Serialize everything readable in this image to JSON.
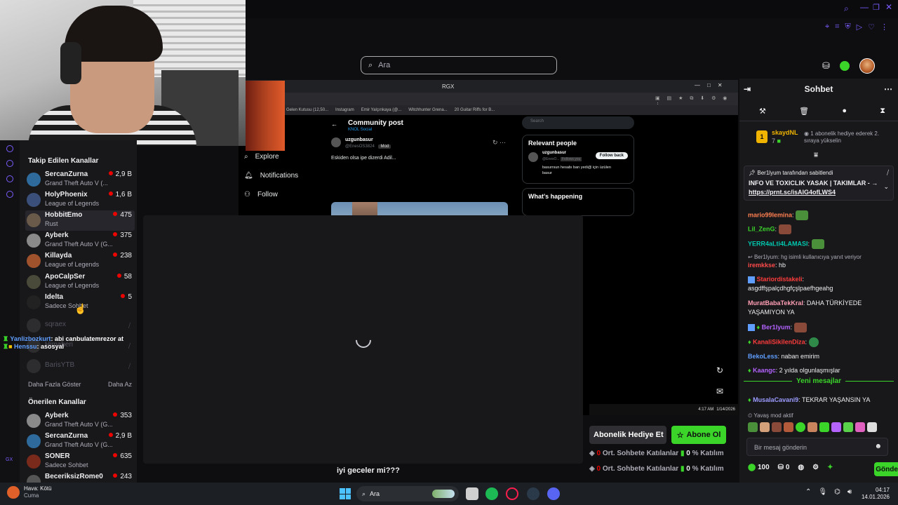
{
  "top_search": {
    "placeholder": "Ara"
  },
  "left_sidebar": {
    "followed_title": "Takip Edilen Kanallar",
    "followed": [
      {
        "name": "SercanZurna",
        "game": "Grand Theft Auto V (...",
        "viewers": "2,9 B"
      },
      {
        "name": "HolyPhoenix",
        "game": "League of Legends",
        "viewers": "1,6 B"
      },
      {
        "name": "HobbitEmo",
        "game": "Rust",
        "viewers": "475"
      },
      {
        "name": "Ayberk",
        "game": "Grand Theft Auto V (G...",
        "viewers": "375"
      },
      {
        "name": "Killayda",
        "game": "League of Legends",
        "viewers": "238"
      },
      {
        "name": "ApoCalpSer",
        "game": "League of Legends",
        "viewers": "58"
      },
      {
        "name": "Idelta",
        "game": "Sadece Sohbet",
        "viewers": "5"
      }
    ],
    "offline": [
      "sqraex",
      "Himaberi",
      "BarisYTB"
    ],
    "show_more": "Daha Fazla Göster",
    "show_less": "Daha Az",
    "recommended_title": "Önerilen Kanallar",
    "recommended": [
      {
        "name": "Ayberk",
        "game": "Grand Theft Auto V (G...",
        "viewers": "353"
      },
      {
        "name": "SercanZurna",
        "game": "Grand Theft Auto V (G...",
        "viewers": "2,9 B"
      },
      {
        "name": "SONER",
        "game": "Sadece Sohbet",
        "viewers": "635"
      },
      {
        "name": "BeceriksizRome0",
        "game": "",
        "viewers": "243"
      }
    ],
    "overlay_chat": [
      {
        "user": "Yanlizbozkurt",
        "text": ": abi canbulatemrezor at"
      },
      {
        "user": "Henssu",
        "text": ": asosyal"
      }
    ]
  },
  "embedded_browser": {
    "tab_title": "RGX",
    "bookmarks": [
      "Gelen Kutusu (12,50...",
      "Instagram",
      "Emir Yalçınkaya (@...",
      "Witchhunter Grena...",
      "20 Guitar Riffs for B..."
    ],
    "nav": [
      "Explore",
      "Notifications",
      "Follow"
    ],
    "post_header": "Community post",
    "post_sub": "KNOL Social",
    "post_user": "uzgunbasur",
    "post_handle": "@EnesOS3824",
    "post_badge": "Mod",
    "post_text": "Eskiden olsa ipe dizerdi Adil...",
    "search_placeholder": "Search",
    "relevant_title": "Relevant people",
    "relevant_user": "uzgunbasur",
    "relevant_handle": "@EnesO...",
    "relevant_badge": "Follows you",
    "relevant_bio": "basurrsun hesabı ban yedi@ için üzülen basur",
    "follow_back": "Follow back",
    "happening_title": "What's happening",
    "clock_time": "4:17 AM",
    "clock_date": "1/14/2026"
  },
  "modal": {
    "caption": "iyi geceler mi???"
  },
  "stream_actions": {
    "gift_label": "Abonelik Hediye Et",
    "sub_label": "Abone Ol",
    "stat_lines": [
      {
        "a": "0",
        "label1": "Ort. Sohbete Katılanlar",
        "b": "0",
        "label2": "% Katılım"
      },
      {
        "a": "0",
        "label1": "Ort. Sohbete Katılanlar",
        "b": "0",
        "label2": "% Katılım"
      }
    ]
  },
  "chat": {
    "title": "Sohbet",
    "top_gifter": {
      "name": "skaydNL",
      "count": "7",
      "rank": "1"
    },
    "gift_note": "1 abonelik hediye ederek 2. sıraya yükselin",
    "pinned_by": "Ber1lyum tarafından sabitlendi",
    "pinned_text": "INFO VE TOXICLIK YASAK | TAKIMLAR - →",
    "pinned_link": "https://prnt.sc/isAlG4ofLWS4",
    "messages": [
      {
        "user": "mario99lemina",
        "text": ":",
        "color": "#ff7f50"
      },
      {
        "user": "Lil_ZenG",
        "text": ":",
        "color": "#3bd52a"
      },
      {
        "user": "YERR4aLti4LAMASI",
        "text": ":",
        "color": "#00c8af"
      },
      {
        "reply": "Ber1lyum: hg isimli kullanıcıya yanıt veriyor",
        "user": "iremkkse",
        "text": ": hb",
        "color": "#ff4a4a"
      },
      {
        "user": "Stariordistakeli",
        "text": ":",
        "color": "#ff3c3c",
        "text2": "asgdffşpalçdhgfçşlpaefhgeahg"
      },
      {
        "user": "MuratBabaTekKral",
        "text": ": DAHA TÜRKİYEDE YAŞAMIYON YA",
        "color": "#ff9fb4"
      },
      {
        "user": "Ber1lyum",
        "text": ":",
        "color": "#b463ff"
      },
      {
        "user": "KanaliSikilenDiza",
        "text": ":",
        "color": "#ff3c3c"
      },
      {
        "user": "BekoLess",
        "text": ": naban emirim",
        "color": "#5f9eff"
      },
      {
        "user": "Kaangc",
        "text": ": 2 yılda olgunlaşmışlar",
        "color": "#b463ff"
      },
      {
        "user": "MusalaCavani9",
        "text": ": TEKRAR YAŞANSIN YA",
        "color": "#9b9bff"
      }
    ],
    "new_messages": "Yeni mesajlar",
    "slow_mode": "Yavaş mod aktif",
    "input_placeholder": "Bir mesaj gönderin",
    "points": "100",
    "other_count": "0",
    "send_label": "Gönder"
  },
  "taskbar": {
    "weather_title": "Hava: Kötü",
    "weather_sub": "Cuma",
    "search_label": "Ara",
    "time": "04:17",
    "date": "14.01.2026"
  },
  "colors": {
    "accent": "#3bd52a",
    "live": "#eb0400",
    "purple": "#7b5cff"
  }
}
